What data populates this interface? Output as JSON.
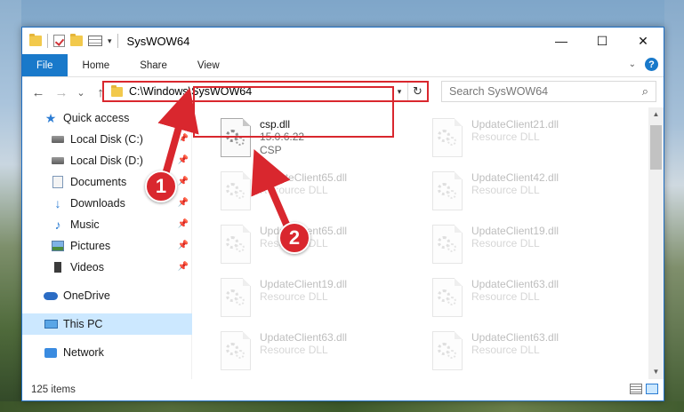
{
  "window": {
    "title": "SysWOW64",
    "controls": {
      "minimize": "—",
      "maximize": "☐",
      "close": "✕"
    }
  },
  "ribbon": {
    "tabs": [
      "File",
      "Home",
      "Share",
      "View"
    ],
    "expand_icon": "chevron-down-icon",
    "help_label": "?"
  },
  "navigation": {
    "back": "←",
    "forward": "→",
    "recent": "⌄",
    "up": "↑"
  },
  "address": {
    "path": "C:\\Windows\\SysWOW64",
    "dropdown": "▾",
    "refresh": "↻"
  },
  "search": {
    "placeholder": "Search SysWOW64",
    "icon": "search-icon"
  },
  "sidebar": {
    "items": [
      {
        "label": "Quick access",
        "icon": "star-icon",
        "pinned": false
      },
      {
        "label": "Local Disk (C:)",
        "icon": "drive-icon",
        "pinned": true
      },
      {
        "label": "Local Disk (D:)",
        "icon": "drive-icon",
        "pinned": true
      },
      {
        "label": "Documents",
        "icon": "documents-icon",
        "pinned": true
      },
      {
        "label": "Downloads",
        "icon": "download-icon",
        "pinned": true
      },
      {
        "label": "Music",
        "icon": "music-icon",
        "pinned": true
      },
      {
        "label": "Pictures",
        "icon": "pictures-icon",
        "pinned": true
      },
      {
        "label": "Videos",
        "icon": "videos-icon",
        "pinned": true
      },
      {
        "label": "OneDrive",
        "icon": "cloud-icon",
        "pinned": false
      },
      {
        "label": "This PC",
        "icon": "computer-icon",
        "pinned": false,
        "selected": true
      },
      {
        "label": "Network",
        "icon": "network-icon",
        "pinned": false
      }
    ]
  },
  "files": [
    {
      "name": "csp.dll",
      "line2": "15.0.6.22",
      "line3": "CSP",
      "highlighted": true
    },
    {
      "name": "UpdateClient21.dll",
      "line2": "Resource DLL"
    },
    {
      "name": "UpdateClient65.dll",
      "line2": "Resource DLL"
    },
    {
      "name": "UpdateClient42.dll",
      "line2": "Resource DLL"
    },
    {
      "name": "UpdateClient65.dll",
      "line2": "Resource DLL"
    },
    {
      "name": "UpdateClient19.dll",
      "line2": "Resource DLL"
    },
    {
      "name": "UpdateClient19.dll",
      "line2": "Resource DLL"
    },
    {
      "name": "UpdateClient63.dll",
      "line2": "Resource DLL"
    },
    {
      "name": "UpdateClient63.dll",
      "line2": "Resource DLL"
    },
    {
      "name": "UpdateClient63.dll",
      "line2": "Resource DLL"
    }
  ],
  "status": {
    "item_count": "125 items"
  },
  "annotations": {
    "step1": "1",
    "step2": "2"
  },
  "colors": {
    "accent": "#1979ca",
    "highlight_red": "#d9272e",
    "selection": "#cce8ff"
  }
}
